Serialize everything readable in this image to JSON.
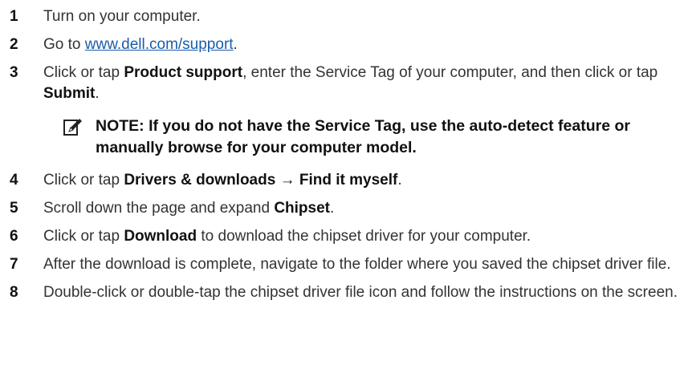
{
  "steps": [
    {
      "num": "1",
      "text": "Turn on your computer."
    },
    {
      "num": "2",
      "pre": "Go to ",
      "link": "www.dell.com/support",
      "post": "."
    },
    {
      "num": "3",
      "t1": "Click or tap ",
      "b1": "Product support",
      "t2": ", enter the Service Tag of your computer, and then click or tap ",
      "b2": "Submit",
      "t3": "."
    },
    {
      "num": "4",
      "t1": "Click or tap ",
      "b1": "Drivers & downloads → Find it myself",
      "t2": "."
    },
    {
      "num": "5",
      "t1": "Scroll down the page and expand ",
      "b1": "Chipset",
      "t2": "."
    },
    {
      "num": "6",
      "t1": "Click or tap ",
      "b1": "Download",
      "t2": " to download the chipset driver for your computer."
    },
    {
      "num": "7",
      "text": "After the download is complete, navigate to the folder where you saved the chipset driver file."
    },
    {
      "num": "8",
      "text": "Double-click or double-tap the chipset driver file icon and follow the instructions on the screen."
    }
  ],
  "note": {
    "icon": "pencil-note-icon",
    "text": "NOTE: If you do not have the Service Tag, use the auto-detect feature or manually browse for your computer model."
  }
}
